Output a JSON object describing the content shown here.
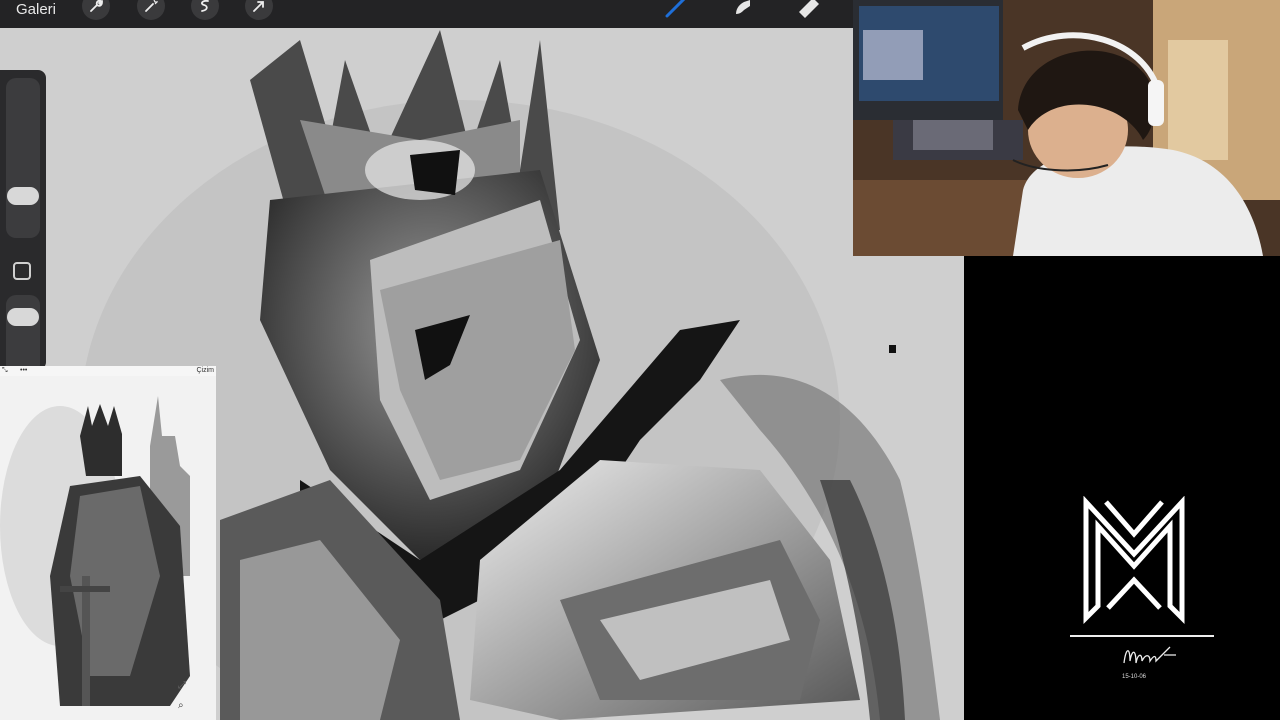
{
  "toolbar": {
    "gallery_label": "Galeri",
    "tools": [
      "wrench-icon",
      "magic-wand-icon",
      "selection-icon",
      "transform-arrow-icon"
    ],
    "right_tools": [
      "brush-icon",
      "smudge-icon",
      "eraser-icon"
    ],
    "accent_color": "#1e6fd9"
  },
  "reference": {
    "more_label": "•••",
    "title_label": "Çizim"
  },
  "logo": {
    "monogram": "MM",
    "signature": "Murat",
    "date": "15-10-06"
  }
}
